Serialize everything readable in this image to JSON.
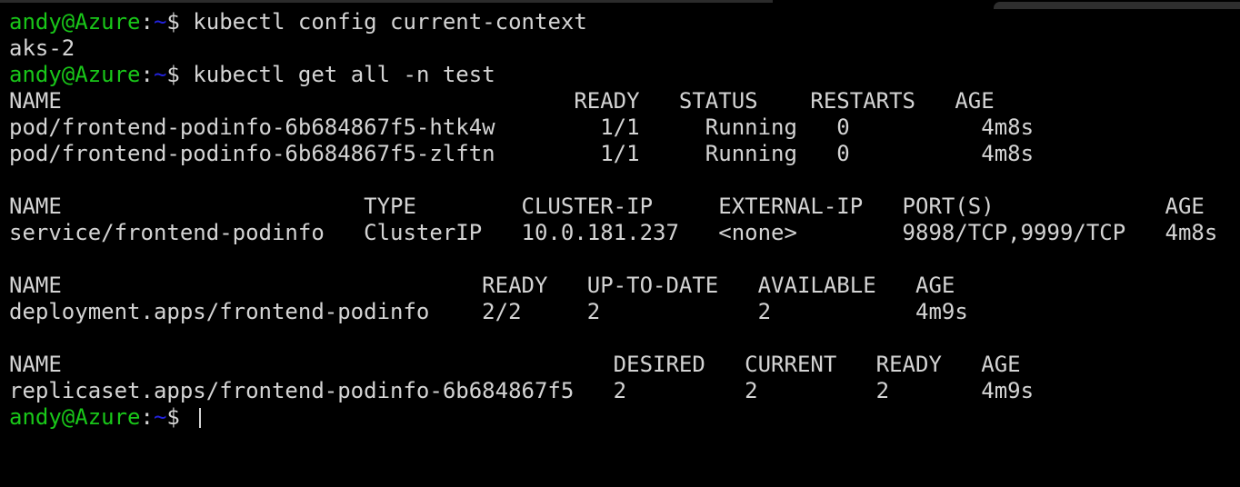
{
  "terminal": {
    "background_color": "#000000",
    "foreground_color": "#d4d4d4",
    "prompt_user_color": "#19c719",
    "prompt_path_color": "#2222dd",
    "prompt": {
      "user_host": "andy@Azure",
      "colon": ":",
      "path": "~",
      "dollar": "$"
    },
    "lines": [
      {
        "type": "prompt",
        "command": " kubectl config current-context"
      },
      {
        "type": "output",
        "text": "aks-2"
      },
      {
        "type": "prompt",
        "command": " kubectl get all -n test"
      },
      {
        "type": "output",
        "text": "NAME                                       READY   STATUS    RESTARTS   AGE"
      },
      {
        "type": "output",
        "text": "pod/frontend-podinfo-6b684867f5-htk4w        1/1     Running   0          4m8s"
      },
      {
        "type": "output",
        "text": "pod/frontend-podinfo-6b684867f5-zlftn        1/1     Running   0          4m8s"
      },
      {
        "type": "blank",
        "text": ""
      },
      {
        "type": "output",
        "text": "NAME                       TYPE        CLUSTER-IP     EXTERNAL-IP   PORT(S)             AGE"
      },
      {
        "type": "output",
        "text": "service/frontend-podinfo   ClusterIP   10.0.181.237   <none>        9898/TCP,9999/TCP   4m8s"
      },
      {
        "type": "blank",
        "text": ""
      },
      {
        "type": "output",
        "text": "NAME                                READY   UP-TO-DATE   AVAILABLE   AGE"
      },
      {
        "type": "output",
        "text": "deployment.apps/frontend-podinfo    2/2     2            2           4m9s"
      },
      {
        "type": "blank",
        "text": ""
      },
      {
        "type": "output",
        "text": "NAME                                          DESIRED   CURRENT   READY   AGE"
      },
      {
        "type": "output",
        "text": "replicaset.apps/frontend-podinfo-6b684867f5   2         2         2       4m9s"
      },
      {
        "type": "prompt-cursor",
        "command": " "
      }
    ],
    "tables": {
      "pods": {
        "headers": [
          "NAME",
          "READY",
          "STATUS",
          "RESTARTS",
          "AGE"
        ],
        "rows": [
          [
            "pod/frontend-podinfo-6b684867f5-htk4w",
            "1/1",
            "Running",
            "0",
            "4m8s"
          ],
          [
            "pod/frontend-podinfo-6b684867f5-zlftn",
            "1/1",
            "Running",
            "0",
            "4m8s"
          ]
        ]
      },
      "services": {
        "headers": [
          "NAME",
          "TYPE",
          "CLUSTER-IP",
          "EXTERNAL-IP",
          "PORT(S)",
          "AGE"
        ],
        "rows": [
          [
            "service/frontend-podinfo",
            "ClusterIP",
            "10.0.181.237",
            "<none>",
            "9898/TCP,9999/TCP",
            "4m8s"
          ]
        ]
      },
      "deployments": {
        "headers": [
          "NAME",
          "READY",
          "UP-TO-DATE",
          "AVAILABLE",
          "AGE"
        ],
        "rows": [
          [
            "deployment.apps/frontend-podinfo",
            "2/2",
            "2",
            "2",
            "4m9s"
          ]
        ]
      },
      "replicasets": {
        "headers": [
          "NAME",
          "DESIRED",
          "CURRENT",
          "READY",
          "AGE"
        ],
        "rows": [
          [
            "replicaset.apps/frontend-podinfo-6b684867f5",
            "2",
            "2",
            "2",
            "4m9s"
          ]
        ]
      }
    },
    "commands": [
      "kubectl config current-context",
      "kubectl get all -n test"
    ],
    "current_context": "aks-2"
  }
}
